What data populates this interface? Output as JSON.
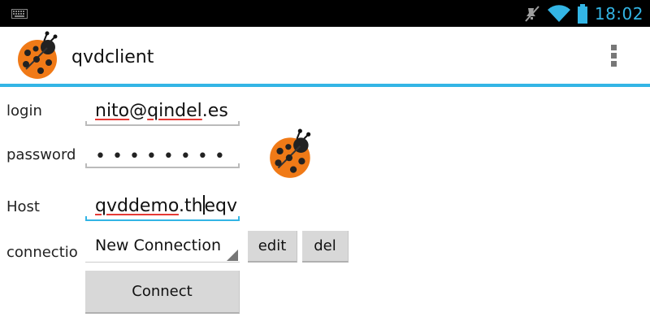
{
  "status_bar": {
    "clock": "18:02",
    "icons": [
      "keyboard-icon",
      "mute-icon",
      "wifi-icon",
      "battery-icon"
    ],
    "accent_color": "#33b5e5"
  },
  "action_bar": {
    "title": "qvdclient",
    "logo": "ladybug-logo",
    "overflow": "overflow-menu-icon"
  },
  "form": {
    "login": {
      "label": "login",
      "value_a": "nito",
      "value_b": "@",
      "value_c": "qindel",
      "value_d": ".es"
    },
    "password": {
      "label": "password",
      "value": "••••••••"
    },
    "host": {
      "label": "Host",
      "value_a": "qvddemo",
      "value_b": ".th",
      "value_c": "eqv"
    },
    "connection": {
      "label": "connectio",
      "selected": "New Connection"
    },
    "buttons": {
      "edit": "edit",
      "del": "del",
      "connect": "Connect"
    }
  }
}
